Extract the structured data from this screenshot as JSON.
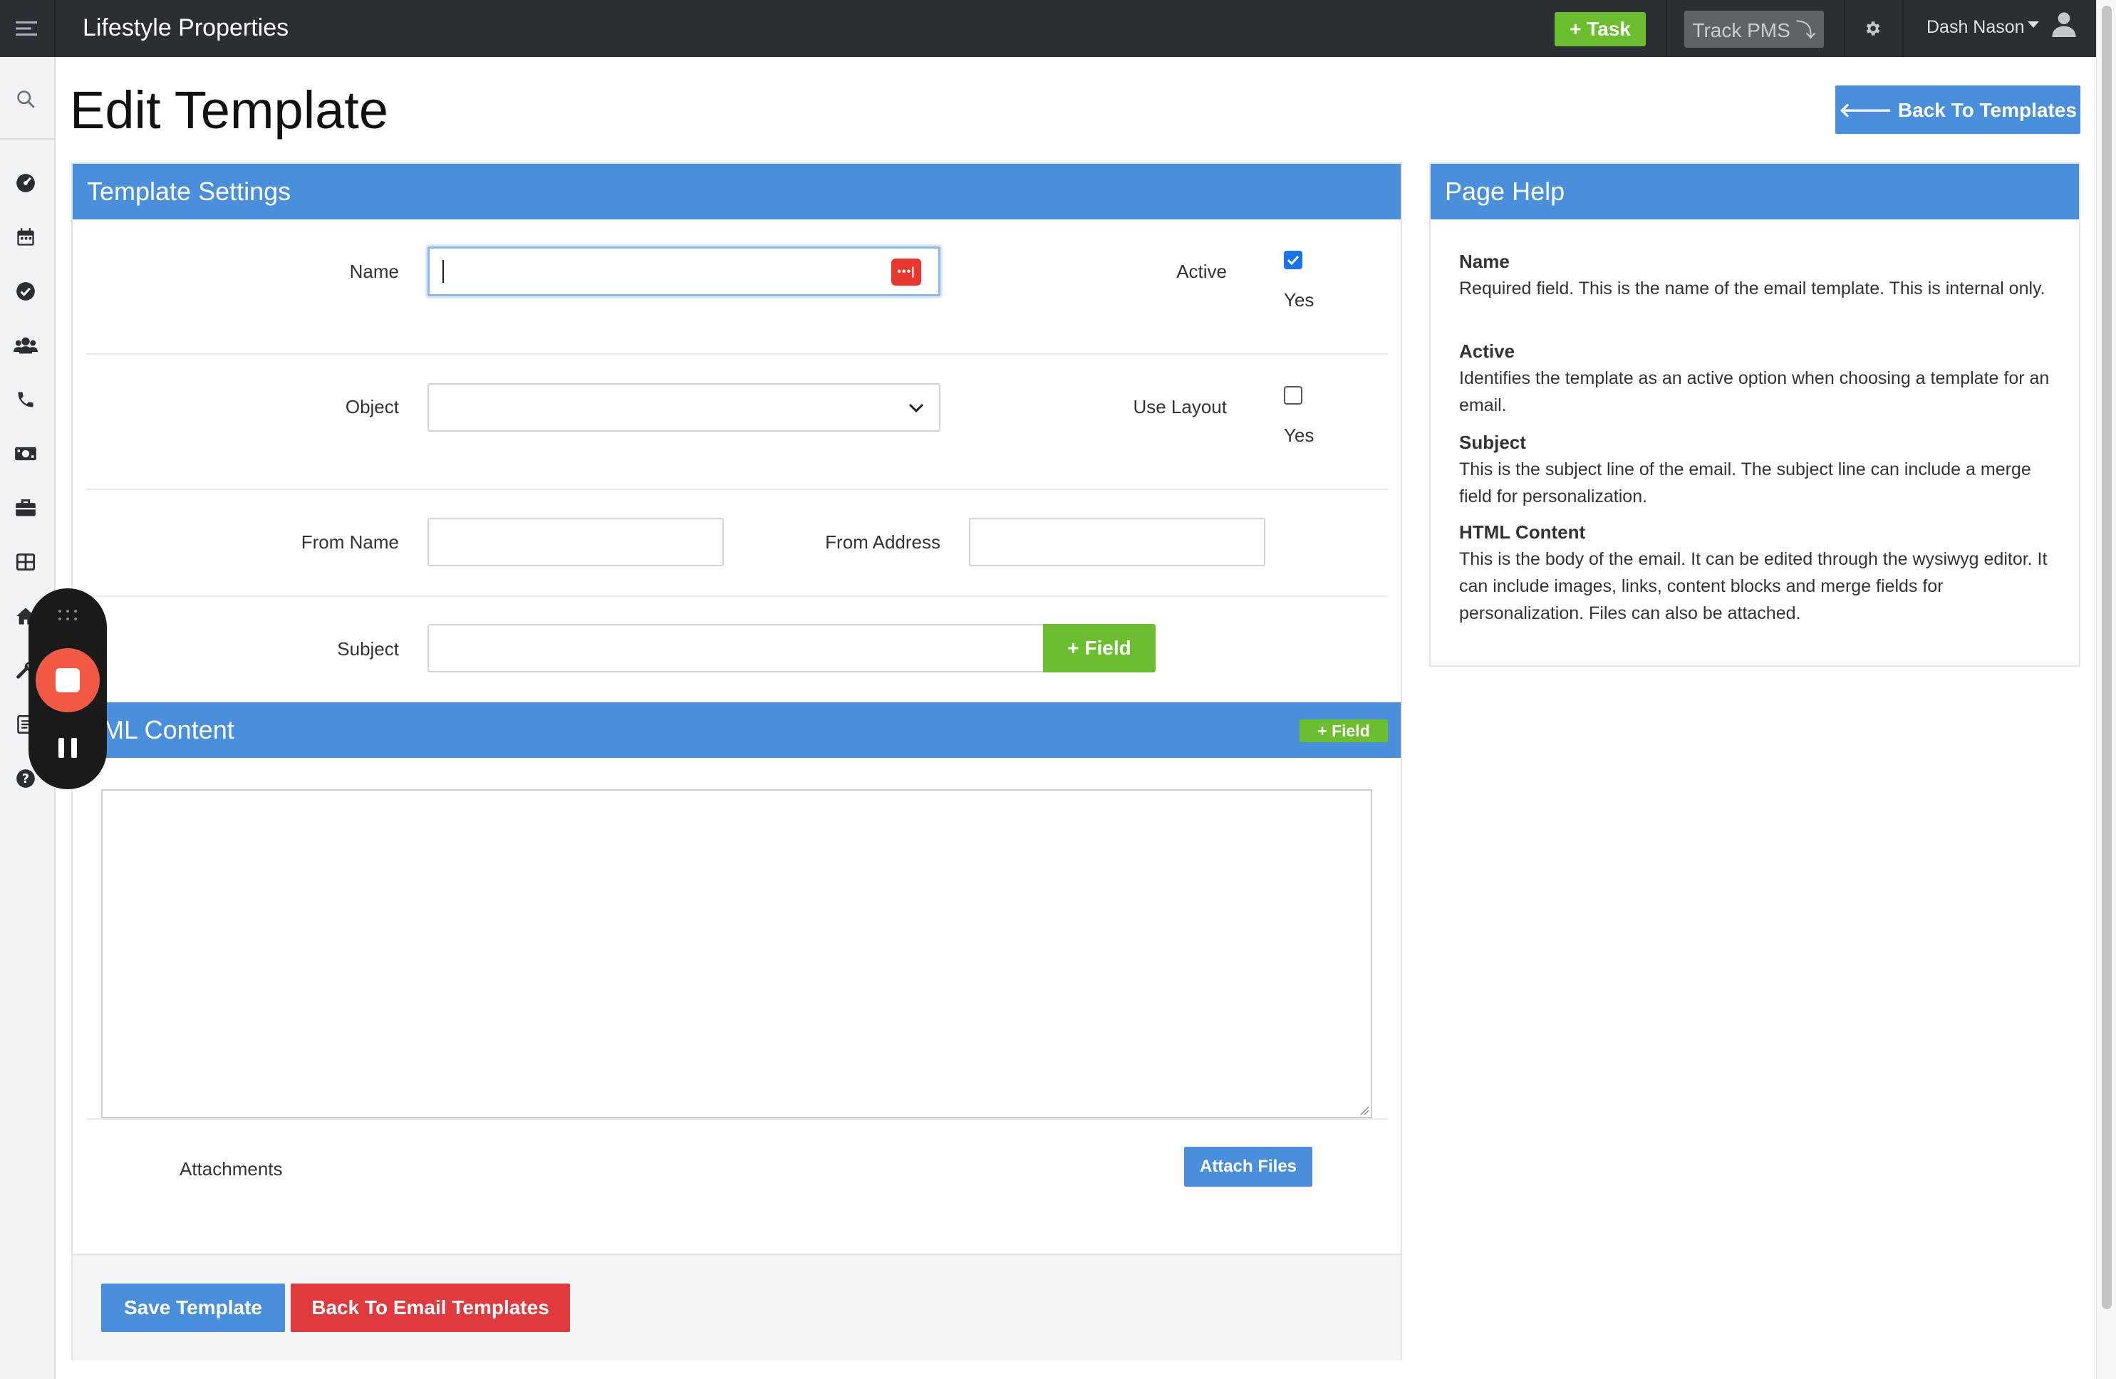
{
  "topbar": {
    "app_title": "Lifestyle Properties",
    "task_label": "+ Task",
    "track_label": "Track PMS ⤵",
    "user_name": "Dash Nason"
  },
  "page": {
    "title": "Edit Template",
    "back_to_templates": "🡐 Back To Templates"
  },
  "settings": {
    "heading": "Template Settings",
    "name_label": "Name",
    "name_value": "",
    "active_label": "Active",
    "active_checked": true,
    "active_yes": "Yes",
    "object_label": "Object",
    "object_value": "",
    "use_layout_label": "Use Layout",
    "use_layout_checked": false,
    "use_layout_yes": "Yes",
    "from_name_label": "From Name",
    "from_name_value": "",
    "from_address_label": "From Address",
    "from_address_value": "",
    "subject_label": "Subject",
    "subject_value": "",
    "field_button": "+ Field",
    "html_heading": "TML Content",
    "html_field_button": "+ Field",
    "html_value": "",
    "attachments_label": "Attachments",
    "attach_files_button": "Attach Files",
    "save_button": "Save Template",
    "back_email_button": "Back To Email Templates"
  },
  "help": {
    "heading": "Page Help",
    "items": [
      {
        "title": "Name",
        "text": "Required field. This is the name of the email template. This is internal only."
      },
      {
        "title": "Active",
        "text": "Identifies the template as an active option when choosing a template for an email."
      },
      {
        "title": "Subject",
        "text": "This is the subject line of the email. The subject line can include a merge field for personalization."
      },
      {
        "title": "HTML Content",
        "text": "This is the body of the email. It can be edited through the wysiwyg editor. It can include images, links, content blocks and merge fields for personalization. Files can also be attached."
      }
    ]
  },
  "icons": {
    "menu": "menu-icon",
    "gear": "gear-icon",
    "user": "user-icon",
    "sidebar": [
      "search-icon",
      "dashboard-icon",
      "calendar-icon",
      "check-circle-icon",
      "users-icon",
      "phone-icon",
      "money-icon",
      "briefcase-icon",
      "table-icon",
      "home-icon",
      "wrench-icon",
      "list-icon",
      "help-icon"
    ]
  },
  "colors": {
    "primary": "#4a8fdc",
    "success": "#6bbf2e",
    "danger": "#e0393e",
    "topbar": "#2b2f33"
  }
}
